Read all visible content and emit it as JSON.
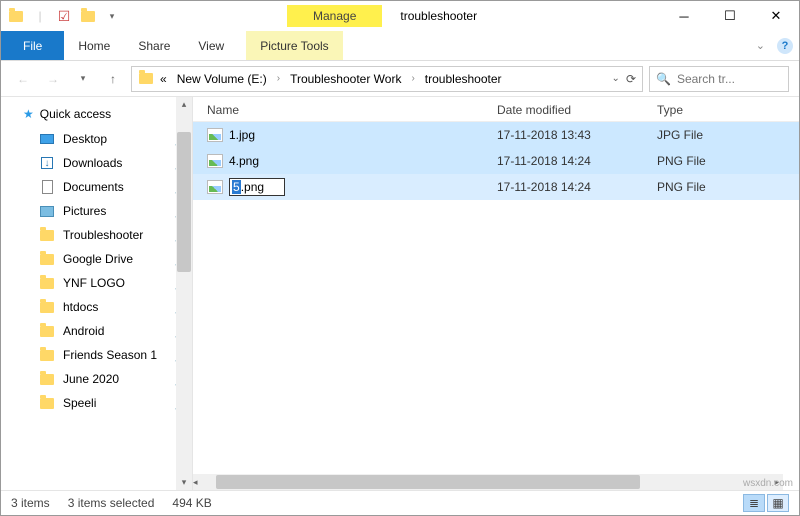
{
  "titlebar": {
    "context_tab": "Manage",
    "window_title": "troubleshooter"
  },
  "ribbon": {
    "file": "File",
    "home": "Home",
    "share": "Share",
    "view": "View",
    "picture_tools": "Picture Tools"
  },
  "address": {
    "prefix": "«",
    "crumbs": [
      "New Volume (E:)",
      "Troubleshooter Work",
      "troubleshooter"
    ],
    "search_placeholder": "Search tr..."
  },
  "sidebar": {
    "quick_access": "Quick access",
    "items": [
      {
        "label": "Desktop",
        "icon": "desktop"
      },
      {
        "label": "Downloads",
        "icon": "download"
      },
      {
        "label": "Documents",
        "icon": "document"
      },
      {
        "label": "Pictures",
        "icon": "picture"
      },
      {
        "label": "Troubleshooter",
        "icon": "folder"
      },
      {
        "label": "Google Drive",
        "icon": "folder"
      },
      {
        "label": "YNF LOGO",
        "icon": "folder"
      },
      {
        "label": "htdocs",
        "icon": "folder"
      },
      {
        "label": "Android",
        "icon": "folder"
      },
      {
        "label": "Friends Season 1",
        "icon": "folder"
      },
      {
        "label": "June 2020",
        "icon": "folder"
      },
      {
        "label": "Speeli",
        "icon": "folder"
      }
    ]
  },
  "columns": {
    "name": "Name",
    "date": "Date modified",
    "type": "Type"
  },
  "files": [
    {
      "name": "1.jpg",
      "date": "17-11-2018 13:43",
      "type": "JPG File",
      "state": "selected"
    },
    {
      "name": "4.png",
      "date": "17-11-2018 14:24",
      "type": "PNG File",
      "state": "selected"
    },
    {
      "name": "5.png",
      "date": "17-11-2018 14:24",
      "type": "PNG File",
      "state": "rename"
    }
  ],
  "rename": {
    "selected_part": "5",
    "rest": ".png"
  },
  "status": {
    "count": "3 items",
    "selected": "3 items selected",
    "size": "494 KB"
  },
  "watermark": "wsxdn.com"
}
